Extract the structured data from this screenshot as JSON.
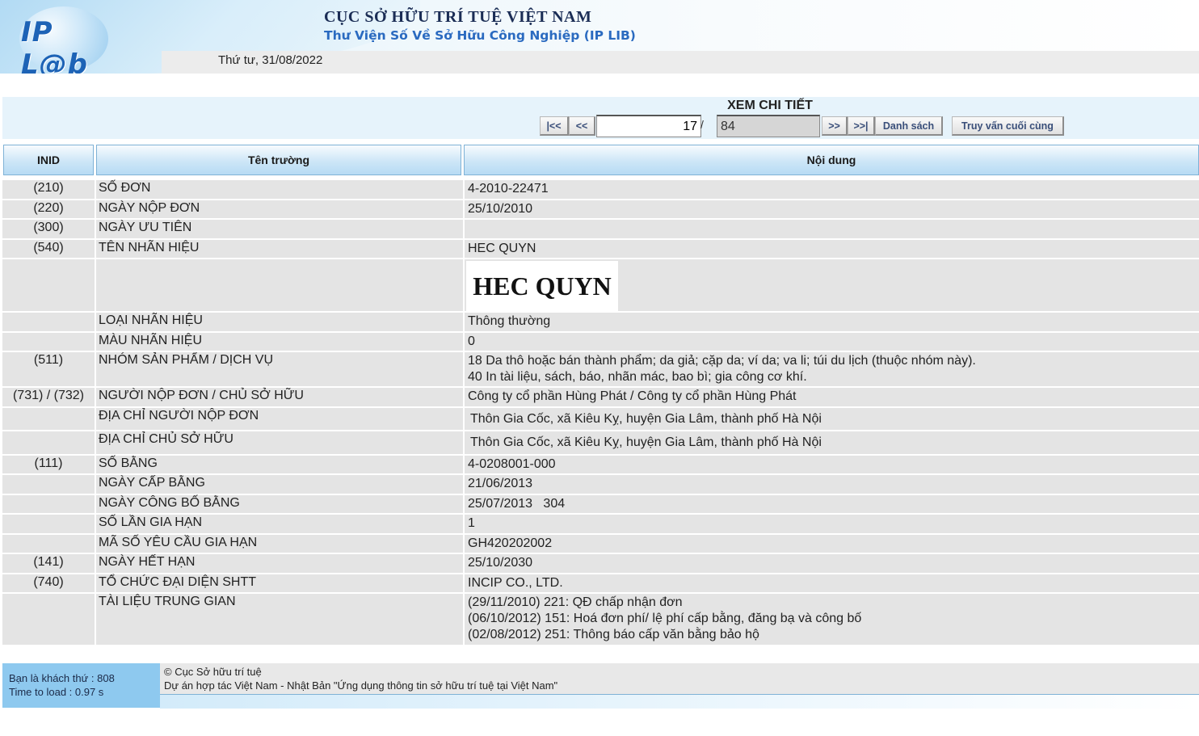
{
  "header": {
    "logo_text": "IP L@b",
    "title": "CỤC SỞ HỮU TRÍ TUỆ VIỆT NAM",
    "subtitle": "Thư Viện Số Về Sở Hữu Công Nghiệp (IP LIB)",
    "date": "Thứ tư, 31/08/2022"
  },
  "toolbar": {
    "title": "XEM CHI TIẾT",
    "first": "|<<",
    "prev": "<<",
    "page_value": "17",
    "separator": "/",
    "total_value": "84",
    "next": ">>",
    "last": ">>|",
    "list": "Danh sách",
    "last_query": "Truy vấn cuối cùng"
  },
  "table": {
    "headers": [
      "INID",
      "Tên trường",
      "Nội dung"
    ],
    "rows": [
      {
        "inid": "(210)",
        "field": "SỐ ĐƠN",
        "value": [
          "4-2010-22471"
        ]
      },
      {
        "inid": "(220)",
        "field": "NGÀY NỘP ĐƠN",
        "value": [
          "25/10/2010"
        ]
      },
      {
        "inid": "(300)",
        "field": "NGÀY ƯU TIÊN",
        "value": [
          ""
        ]
      },
      {
        "inid": "(540)",
        "field": "TÊN NHÃN HIỆU",
        "value": [
          "HEC QUYN"
        ]
      },
      {
        "inid": "",
        "field": "",
        "mark_image": "HEC QUYN"
      },
      {
        "inid": "",
        "field": "LOẠI NHÃN HIỆU",
        "value": [
          "Thông thường"
        ]
      },
      {
        "inid": "",
        "field": "MÀU NHÃN HIỆU",
        "value": [
          "0"
        ]
      },
      {
        "inid": "(511)",
        "field": "NHÓM SẢN PHẨM / DỊCH VỤ",
        "value": [
          "18 Da thô hoặc bán thành phẩm; da giả; cặp da; ví da; va li; túi du lịch (thuộc nhóm này).",
          "40 In tài liệu, sách, báo, nhãn mác, bao bì; gia công cơ khí."
        ]
      },
      {
        "inid": "(731) / (732)",
        "field": "NGƯỜI NỘP ĐƠN / CHỦ SỞ HỮU",
        "value": [
          "Công ty cổ phần Hùng Phát / Công ty cổ phần Hùng Phát"
        ]
      },
      {
        "inid": "",
        "field": "ĐỊA CHỈ NGƯỜI NỘP ĐƠN",
        "value": [
          "Thôn Gia Cốc, xã Kiêu Kỵ, huyện Gia Lâm, thành phố Hà Nội"
        ]
      },
      {
        "inid": "",
        "field": "ĐỊA CHỈ CHỦ SỞ HỮU",
        "value": [
          "Thôn Gia Cốc, xã Kiêu Kỵ, huyện Gia Lâm, thành phố Hà Nội"
        ]
      },
      {
        "inid": "(111)",
        "field": "SỐ BẰNG",
        "value": [
          "4-0208001-000"
        ]
      },
      {
        "inid": "",
        "field": "NGÀY CẤP BẰNG",
        "value": [
          "21/06/2013"
        ]
      },
      {
        "inid": "",
        "field": "NGÀY CÔNG BỐ BẰNG",
        "value": [
          "25/07/2013   304"
        ]
      },
      {
        "inid": "",
        "field": "SỐ LẦN GIA HẠN",
        "value": [
          "1"
        ]
      },
      {
        "inid": "",
        "field": "MÃ SỐ YÊU CẦU GIA HẠN",
        "value": [
          "GH420202002"
        ]
      },
      {
        "inid": "(141)",
        "field": "NGÀY HẾT HẠN",
        "value": [
          "25/10/2030"
        ]
      },
      {
        "inid": "(740)",
        "field": "TỔ CHỨC ĐẠI DIỆN SHTT",
        "value": [
          "INCIP CO., LTD."
        ]
      },
      {
        "inid": "",
        "field": "TÀI LIỆU TRUNG GIAN",
        "value": [
          "(29/11/2010) 221: QĐ chấp nhận đơn",
          "(06/10/2012) 151: Hoá đơn phí/ lệ phí cấp bằng, đăng bạ và công bố",
          "(02/08/2012) 251: Thông báo cấp văn bằng bảo hộ"
        ]
      }
    ]
  },
  "footer": {
    "visitor": "Bạn là khách thứ : 808",
    "load_time": "Time to load : 0.97 s",
    "copyright": "© Cục Sở hữu trí tuệ",
    "project": "Dự án hợp tác Việt Nam - Nhật Bản \"Ứng dụng thông tin sở hữu trí tuệ tại Việt Nam\""
  }
}
